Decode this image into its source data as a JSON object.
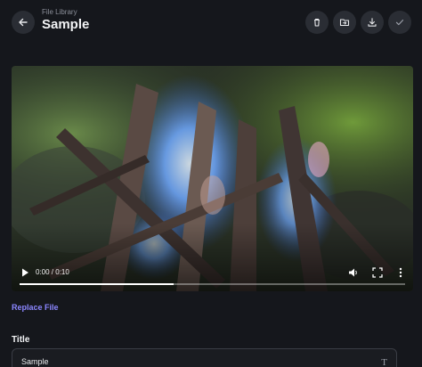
{
  "header": {
    "breadcrumb": "File Library",
    "title": "Sample",
    "actions": [
      "trash-icon",
      "folder-move-icon",
      "download-icon",
      "check-icon"
    ]
  },
  "video": {
    "current_time": "0:00",
    "duration": "0:10",
    "time_display": "0:00 / 0:10",
    "progress": 0.4
  },
  "replace_label": "Replace File",
  "form": {
    "title_label": "Title",
    "title_value": "Sample"
  }
}
